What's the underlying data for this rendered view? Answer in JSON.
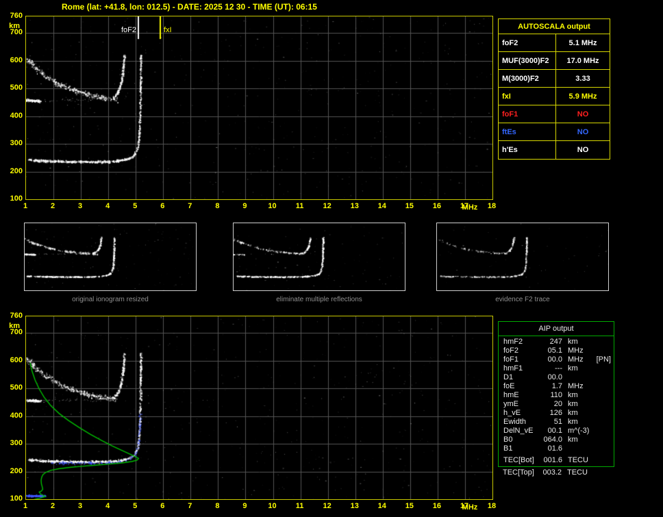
{
  "title": "Rome (lat: +41.8, lon: 012.5) - DATE: 2025 12 30 - TIME (UT): 06:15",
  "autoscala": {
    "title": "AUTOSCALA output",
    "rows": [
      {
        "label": "foF2",
        "value": "5.1 MHz",
        "color": "#ffffff"
      },
      {
        "label": "MUF(3000)F2",
        "value": "17.0 MHz",
        "color": "#ffffff"
      },
      {
        "label": "M(3000)F2",
        "value": "3.33",
        "color": "#ffffff"
      },
      {
        "label": "fxI",
        "value": "5.9 MHz",
        "color": "#ffff00"
      },
      {
        "label": "foF1",
        "value": "NO",
        "color": "#ff2020"
      },
      {
        "label": "ftEs",
        "value": "NO",
        "color": "#3366ff"
      },
      {
        "label": "h'Es",
        "value": "NO",
        "color": "#ffffff"
      }
    ]
  },
  "aip": {
    "title": "AIP output",
    "rows": [
      {
        "label": "hmF2",
        "value": "247",
        "unit": "km",
        "note": ""
      },
      {
        "label": "foF2",
        "value": "05.1",
        "unit": "MHz",
        "note": ""
      },
      {
        "label": "foF1",
        "value": "00.0",
        "unit": "MHz",
        "note": "[PN]"
      },
      {
        "label": "hmF1",
        "value": "---",
        "unit": "km",
        "note": ""
      },
      {
        "label": "D1",
        "value": "00.0",
        "unit": "",
        "note": ""
      },
      {
        "label": "foE",
        "value": "1.7",
        "unit": "MHz",
        "note": ""
      },
      {
        "label": "hmE",
        "value": "110",
        "unit": "km",
        "note": ""
      },
      {
        "label": "ymE",
        "value": "20",
        "unit": "km",
        "note": ""
      },
      {
        "label": "h_vE",
        "value": "126",
        "unit": "km",
        "note": ""
      },
      {
        "label": "Ewidth",
        "value": "51",
        "unit": "km",
        "note": ""
      },
      {
        "label": "DelN_vE",
        "value": "00.1",
        "unit": "m^(-3)",
        "note": ""
      },
      {
        "label": "B0",
        "value": "064.0",
        "unit": "km",
        "note": ""
      },
      {
        "label": "B1",
        "value": "01.6",
        "unit": "",
        "note": ""
      },
      {
        "label": "TEC[Bot]",
        "value": "001.6",
        "unit": "TECU",
        "note": ""
      }
    ],
    "extra_row": {
      "label": "TEC[Top]",
      "value": "003.2",
      "unit": "TECU"
    }
  },
  "thumbnails": [
    {
      "caption": "original ionogram resized"
    },
    {
      "caption": "eliminate multiple reflections"
    },
    {
      "caption": "evidence F2 trace"
    }
  ],
  "ionogram": {
    "x_unit": "MHz",
    "y_unit": "km",
    "x_ticks": [
      1,
      2,
      3,
      4,
      5,
      6,
      7,
      8,
      9,
      10,
      11,
      12,
      13,
      14,
      15,
      16,
      17,
      18
    ],
    "y_ticks": [
      760,
      700,
      600,
      500,
      400,
      300,
      200,
      100
    ],
    "axes": {
      "fmin": 1,
      "fmax": 18,
      "hmin": 100,
      "hmax": 760
    },
    "markers": [
      {
        "label": "foF2",
        "freq": 5.1,
        "color": "#ffffff"
      },
      {
        "label": "fxI",
        "freq": 5.9,
        "color": "#ffff00"
      }
    ],
    "profile_color": "#00c000",
    "traces": [
      {
        "name": "band",
        "points": [
          [
            1.0,
            612
          ],
          [
            1.3,
            578
          ],
          [
            1.7,
            546
          ],
          [
            2.2,
            516
          ],
          [
            2.8,
            492
          ],
          [
            3.4,
            476
          ],
          [
            4.0,
            466
          ],
          [
            4.3,
            462
          ]
        ],
        "jf": 0.07,
        "jh": 9,
        "count": 330,
        "size": 2,
        "a0": 0.18,
        "a1": 0.95
      },
      {
        "name": "hop-flat",
        "points": [
          [
            1.0,
            459
          ],
          [
            1.5,
            456
          ]
        ],
        "jf": 0.05,
        "jh": 4,
        "count": 110,
        "size": 2,
        "a0": 0.45,
        "a1": 1
      },
      {
        "name": "hop-scatter",
        "points": [
          [
            1.6,
            458
          ],
          [
            4.0,
            461
          ]
        ],
        "jf": 0.12,
        "jh": 5,
        "count": 45,
        "size": 1,
        "a0": 0.15,
        "a1": 0.6
      },
      {
        "name": "hop-rise",
        "points": [
          [
            4.15,
            466
          ],
          [
            4.32,
            484
          ],
          [
            4.44,
            512
          ],
          [
            4.51,
            550
          ],
          [
            4.55,
            592
          ],
          [
            4.57,
            625
          ]
        ],
        "jf": 0.035,
        "jh": 5,
        "count": 170,
        "size": 2,
        "a0": 0.35,
        "a1": 1
      },
      {
        "name": "f2-flat",
        "points": [
          [
            1.1,
            244
          ],
          [
            1.6,
            240
          ],
          [
            2.4,
            237
          ],
          [
            3.3,
            236
          ],
          [
            4.1,
            238
          ],
          [
            4.5,
            242
          ],
          [
            4.78,
            250
          ]
        ],
        "jf": 0.04,
        "jh": 4,
        "count": 430,
        "size": 2,
        "a0": 0.5,
        "a1": 1
      },
      {
        "name": "f2-rise",
        "points": [
          [
            4.78,
            250
          ],
          [
            4.95,
            263
          ],
          [
            5.05,
            284
          ],
          [
            5.1,
            318
          ],
          [
            5.13,
            368
          ],
          [
            5.15,
            430
          ],
          [
            5.16,
            500
          ],
          [
            5.17,
            575
          ],
          [
            5.17,
            625
          ]
        ],
        "jf": 0.03,
        "jh": 5,
        "count": 260,
        "size": 2,
        "a0": 0.5,
        "a1": 1
      }
    ],
    "restored": [
      {
        "name": "es-bar",
        "points": [
          [
            1.0,
            114
          ],
          [
            1.7,
            113
          ]
        ],
        "jf": 0.04,
        "jh": 2.5,
        "count": 170,
        "size": 2,
        "a0": 0.55,
        "a1": 1,
        "color": "64,88,255"
      },
      {
        "name": "trace-blue",
        "points": [
          [
            1.9,
            233
          ],
          [
            2.7,
            231
          ],
          [
            3.6,
            231
          ],
          [
            4.3,
            235
          ],
          [
            4.7,
            244
          ],
          [
            4.95,
            260
          ],
          [
            5.07,
            295
          ],
          [
            5.12,
            350
          ],
          [
            5.14,
            410
          ]
        ],
        "jf": 0.05,
        "jh": 4,
        "count": 150,
        "size": 2,
        "a0": 0.4,
        "a1": 0.95,
        "color": "64,88,255"
      }
    ],
    "profile": [
      [
        1.15,
        592
      ],
      [
        1.22,
        562
      ],
      [
        1.33,
        530
      ],
      [
        1.48,
        498
      ],
      [
        1.66,
        468
      ],
      [
        1.9,
        438
      ],
      [
        2.2,
        410
      ],
      [
        2.55,
        384
      ],
      [
        2.95,
        358
      ],
      [
        3.35,
        334
      ],
      [
        3.75,
        312
      ],
      [
        4.15,
        292
      ],
      [
        4.5,
        276
      ],
      [
        4.8,
        262
      ],
      [
        5.02,
        252
      ],
      [
        5.1,
        247
      ],
      [
        5.05,
        241
      ],
      [
        4.85,
        236
      ],
      [
        4.5,
        231
      ],
      [
        4.05,
        227
      ],
      [
        3.55,
        223
      ],
      [
        3.05,
        219
      ],
      [
        2.6,
        215
      ],
      [
        2.2,
        210
      ],
      [
        1.9,
        204
      ],
      [
        1.72,
        197
      ],
      [
        1.62,
        189
      ],
      [
        1.57,
        179
      ],
      [
        1.55,
        168
      ],
      [
        1.56,
        156
      ],
      [
        1.59,
        145
      ],
      [
        1.61,
        136
      ],
      [
        1.56,
        129
      ],
      [
        1.48,
        126
      ],
      [
        1.53,
        119
      ],
      [
        1.65,
        113
      ],
      [
        1.7,
        110
      ],
      [
        1.52,
        104
      ],
      [
        1.3,
        99
      ],
      [
        1.12,
        96
      ]
    ]
  }
}
